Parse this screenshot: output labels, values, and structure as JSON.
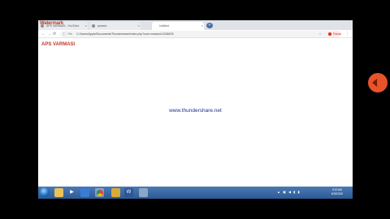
{
  "browser": {
    "watermark": "Watermark",
    "tabs": [
      {
        "label": "APS VARMASI - YouTube",
        "active": false
      },
      {
        "label": "qmaxia",
        "active": false
      },
      {
        "label": "Untitled",
        "active": true
      }
    ],
    "new_tab_label": "+",
    "address": {
      "info_icon": "info-icon",
      "scheme": "File",
      "url": "C:/Users/Apple/Documents/Thundershare/index.php?user=session12345678"
    },
    "profile_label": "Pause",
    "menu_label": "⋮"
  },
  "page": {
    "title": "APS VARMASI",
    "link_text": "www.thundershare.net"
  },
  "taskbar": {
    "icons": [
      "explorer-icon",
      "media-icon",
      "chrome-icon",
      "app-icon",
      "word-icon",
      "paint-icon"
    ],
    "tray_text": "▲ ▣ ◀ ▮ ▮",
    "time": "5:20 AM",
    "date": "8/18/2020"
  },
  "colors": {
    "page_title": "#c0392b",
    "link": "#1a2f8f",
    "taskbar": "#2c5a96",
    "side_orb": "#e8532a"
  }
}
